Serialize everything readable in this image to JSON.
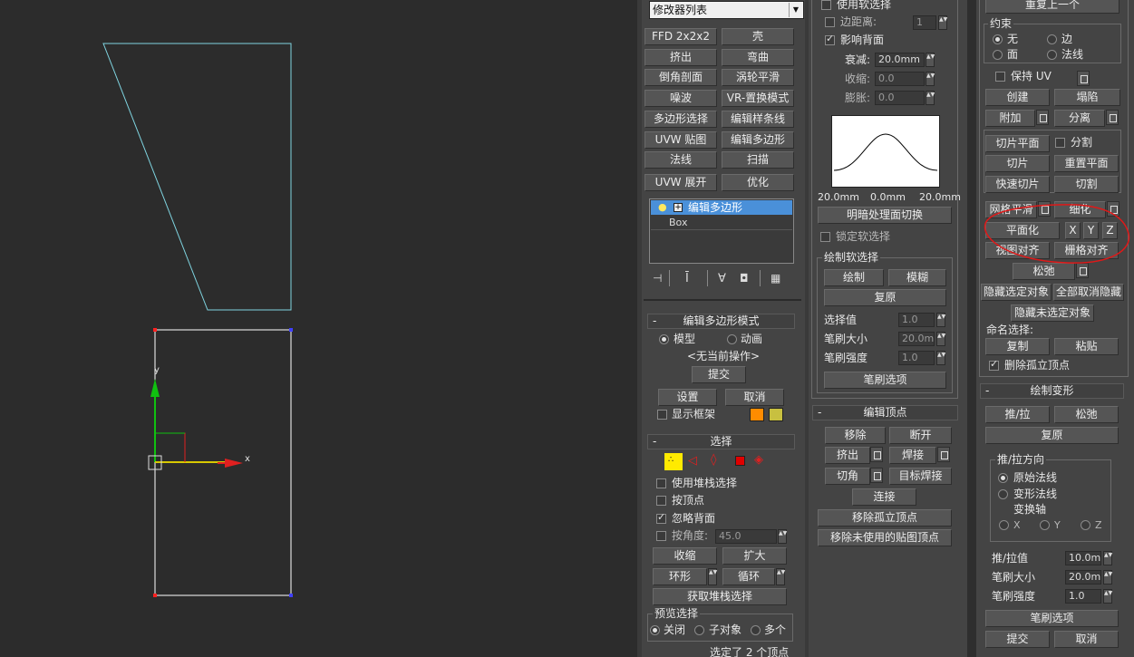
{
  "viewport": {
    "gizmo": {
      "x_label": "x",
      "y_label": "y"
    }
  },
  "modifier_panel": {
    "modifier_list": "修改器列表",
    "buttons": [
      [
        "FFD 2x2x2",
        "壳"
      ],
      [
        "挤出",
        "弯曲"
      ],
      [
        "倒角剖面",
        "涡轮平滑"
      ],
      [
        "噪波",
        "VR-置换模式"
      ],
      [
        "多边形选择",
        "编辑样条线"
      ],
      [
        "UVW 贴图",
        "编辑多边形"
      ],
      [
        "法线",
        "扫描"
      ],
      [
        "UVW 展开",
        "优化"
      ]
    ],
    "stack": {
      "active_item": "编辑多边形",
      "base_item": "Box"
    },
    "edit_poly_mode": {
      "title": "编辑多边形模式",
      "model": "模型",
      "animate": "动画",
      "no_op": "<无当前操作>",
      "commit": "提交",
      "settings": "设置",
      "cancel": "取消",
      "show_cage": "显示框架",
      "cage_color1": "#ff8c00",
      "cage_color2": "#c8c040"
    },
    "selection": {
      "title": "选择",
      "use_stack": "使用堆栈选择",
      "by_vertex": "按顶点",
      "ignore_backfacing": "忽略背面",
      "by_angle": "按角度:",
      "angle_value": "45.0",
      "shrink": "收缩",
      "grow": "扩大",
      "ring": "环形",
      "loop": "循环",
      "get_stack": "获取堆栈选择",
      "preview_title": "预览选择",
      "preview_off": "关闭",
      "preview_sub": "子对象",
      "preview_multi": "多个",
      "status": "选定了 2 个顶点"
    }
  },
  "soft_selection": {
    "use_soft": "使用软选择",
    "edge_distance": "边距离:",
    "edge_value": "1",
    "affect_backfacing": "影响背面",
    "falloff": "衰减:",
    "falloff_value": "20.0mm",
    "pinch": "收缩:",
    "pinch_value": "0.0",
    "bubble": "膨胀:",
    "bubble_value": "0.0",
    "curve_labels": [
      "20.0mm",
      "0.0mm",
      "20.0mm"
    ],
    "shaded_face_toggle": "明暗处理面切换",
    "lock_soft": "锁定软选择",
    "paint_title": "绘制软选择",
    "paint": "绘制",
    "blur": "模糊",
    "revert": "复原",
    "select_value": "选择值",
    "select_value_v": "1.0",
    "brush_size": "笔刷大小",
    "brush_size_v": "20.0mm",
    "brush_strength": "笔刷强度",
    "brush_strength_v": "1.0",
    "brush_options": "笔刷选项"
  },
  "edit_vertices": {
    "title": "编辑顶点",
    "remove": "移除",
    "break": "断开",
    "extrude": "挤出",
    "weld": "焊接",
    "chamfer": "切角",
    "target_weld": "目标焊接",
    "connect": "连接",
    "remove_isolated": "移除孤立顶点",
    "remove_unused_map": "移除未使用的贴图顶点"
  },
  "edit_geometry": {
    "repeat_last": "重复上一个",
    "constraints_title": "约束",
    "c_none": "无",
    "c_edge": "边",
    "c_face": "面",
    "c_normal": "法线",
    "preserve_uv": "保持 UV",
    "create": "创建",
    "collapse": "塌陷",
    "attach": "附加",
    "detach": "分离",
    "slice_plane": "切片平面",
    "split": "分割",
    "slice": "切片",
    "reset_plane": "重置平面",
    "quickslice": "快速切片",
    "cut": "切割",
    "meshsmooth": "网格平滑",
    "tessellate": "细化",
    "make_planar": "平面化",
    "x": "X",
    "y": "Y",
    "z": "Z",
    "view_align": "视图对齐",
    "grid_align": "栅格对齐",
    "relax": "松弛",
    "hide_selected": "隐藏选定对象",
    "unhide_all": "全部取消隐藏",
    "hide_unselected": "隐藏未选定对象",
    "named_selections": "命名选择:",
    "copy": "复制",
    "paste": "粘贴",
    "delete_isolated": "删除孤立顶点"
  },
  "paint_deform": {
    "title": "绘制变形",
    "push_pull": "推/拉",
    "relax": "松弛",
    "revert": "复原",
    "direction_title": "推/拉方向",
    "original_normals": "原始法线",
    "deformed_normals": "变形法线",
    "transform_axis": "变换轴",
    "x": "X",
    "y": "Y",
    "z": "Z",
    "push_value": "推/拉值",
    "push_value_v": "10.0mm",
    "brush_size": "笔刷大小",
    "brush_size_v": "20.0mm",
    "brush_strength": "笔刷强度",
    "brush_strength_v": "1.0",
    "brush_options": "笔刷选项",
    "commit": "提交",
    "cancel": "取消"
  }
}
